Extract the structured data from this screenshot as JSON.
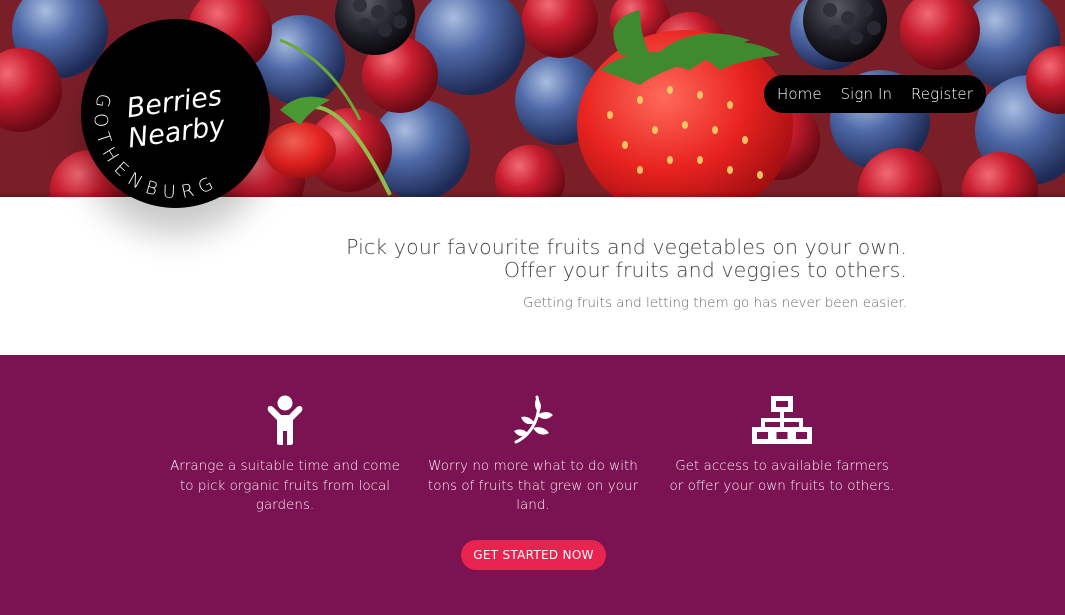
{
  "brand": {
    "name_line1": "Berries",
    "name_line2": "Nearby",
    "city_ring": "GOTHENBURG"
  },
  "nav": {
    "items": [
      {
        "label": "Home"
      },
      {
        "label": "Sign In"
      },
      {
        "label": "Register"
      }
    ]
  },
  "intro": {
    "headline_line1": "Pick your favourite fruits and vegetables on your own.",
    "headline_line2": "Offer your fruits and veggies to others.",
    "subtitle": "Getting fruits and letting them go has never been easier."
  },
  "features": [
    {
      "icon": "child-icon",
      "text": "Arrange a suitable time and come to pick organic fruits from local gardens."
    },
    {
      "icon": "leaf-plant-icon",
      "text": "Worry no more what to do with tons of fruits that grew on your land."
    },
    {
      "icon": "network-icon",
      "text": "Get access to available farmers or offer your own fruits to others."
    }
  ],
  "cta": {
    "label": "GET STARTED NOW"
  },
  "colors": {
    "features_bg": "#7b1252",
    "cta_bg": "#e8234f",
    "nav_bg": "#000000",
    "logo_bg": "#000000"
  }
}
